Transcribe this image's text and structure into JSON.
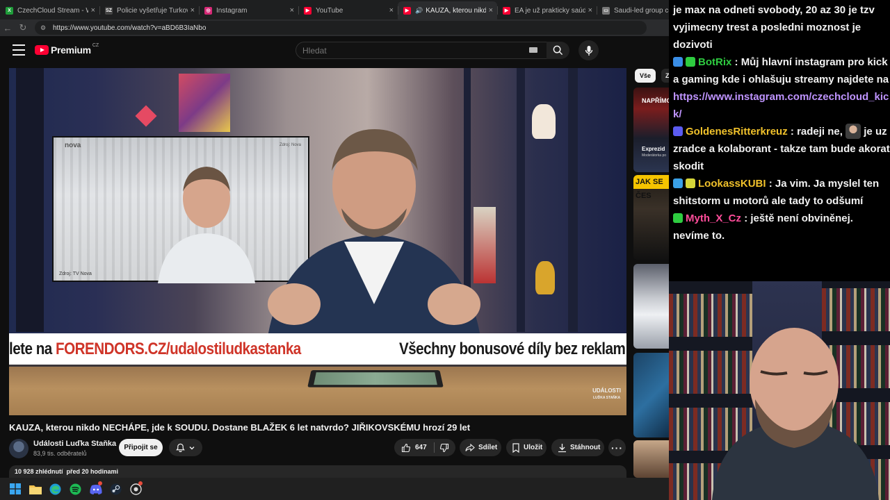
{
  "browser": {
    "tabs": [
      {
        "title": "CzechCloud Stream - Watch",
        "favicon": "xbox-icon",
        "color": "#1f9d3a",
        "active": false
      },
      {
        "title": "Policie vyšetřuje Turkovu nel",
        "favicon": "sz-icon",
        "color": "#444444",
        "active": false
      },
      {
        "title": "Instagram",
        "favicon": "instagram-icon",
        "color": "#d62976",
        "active": false
      },
      {
        "title": "YouTube",
        "favicon": "youtube-icon",
        "color": "#ff0033",
        "active": false
      },
      {
        "title": "KAUZA, kterou nikdo NE",
        "favicon": "youtube-icon",
        "color": "#ff0033",
        "active": true
      },
      {
        "title": "EA je už prakticky saúdská. E",
        "favicon": "youtube-icon",
        "color": "#ff0033",
        "active": false
      },
      {
        "title": "Saudi-led group complet",
        "favicon": "page-icon",
        "color": "#777777",
        "active": false
      }
    ],
    "url": "https://www.youtube.com/watch?v=aBD6B3IaNbo"
  },
  "youtube": {
    "logo_word": "Premium",
    "logo_region": "CZ",
    "search_placeholder": "Hledat",
    "player": {
      "banner_text_a": "lete na ",
      "banner_text_link": "FORENDORS.CZ/udalostiludkastanka",
      "banner_text_b": "Všechny bonusové díly bez reklam",
      "inset_logo": "nova",
      "inset_source": "Zdroj: TV Nova",
      "inset_source_top": "Zdroj: Nova",
      "watermark": "UDÁLOSTI\nLUĎKA STAŇKA"
    },
    "video_title": "KAUZA, kterou nikdo NECHÁPE, jde k SOUDU. Dostane BLAŽEK 6 let natvrdo? JIŘIKOVSKÉMU hrozí 29 let",
    "channel": {
      "name": "Události Luďka Staňka",
      "subscribers": "83,9 tis. odběratelů",
      "join_label": "Připojit se"
    },
    "actions": {
      "like_count": "647",
      "share_label": "Sdílet",
      "save_label": "Uložit",
      "download_label": "Stáhnout"
    },
    "description": {
      "views": "10 928 zhlédnutí",
      "date": "před 20 hodinami"
    },
    "chips": {
      "all": "Vše",
      "second": "Z"
    },
    "thumbnails": {
      "t1_top": "NAPŘÍMO",
      "t1_title": "Exprezid",
      "t1_sub": "Moderátorka po",
      "t2_title": "JAK SE ČES"
    }
  },
  "chat": {
    "messages": [
      {
        "user": "",
        "text": "je max na odneti svobody, 20 az 30 je tzv vyjimecny trest a posledni moznost je dozivoti",
        "user_color": "#ffffff"
      },
      {
        "user": "BotRix",
        "text": "Můj hlavní instagram pro kick a gaming kde i ohlašuju streamy najdete na ",
        "link": "https://www.instagram.com/czechcloud_kick/",
        "user_color": "#2ecc40",
        "badge_colors": [
          "#3a8ee6",
          "#2ecc40"
        ]
      },
      {
        "user": "GoldenesRitterkreuz",
        "text": "radeji ne, ",
        "text2": "je uz zradce a kolaborant - takze tam bude akorat skodit",
        "user_color": "#f0c12b",
        "badge_colors": [
          "#5b5bf0"
        ],
        "has_emote": true
      },
      {
        "user": "LookassKUBI",
        "text": "Ja vim. Ja myslel ten shitstorm u motorů ale tady to odšumí",
        "user_color": "#f0c12b",
        "badge_colors": [
          "#3aa0e6",
          "#d6d639"
        ]
      },
      {
        "user": "Myth_X_Cz",
        "text": "ještě není obviněnej. nevíme to.",
        "user_color": "#ff4d9a",
        "badge_colors": [
          "#2ecc40"
        ]
      }
    ]
  },
  "taskbar": {
    "apps": [
      "windows-icon",
      "explorer-icon",
      "edge-icon",
      "spotify-icon",
      "discord-icon",
      "steam-icon",
      "recorder-icon"
    ]
  }
}
